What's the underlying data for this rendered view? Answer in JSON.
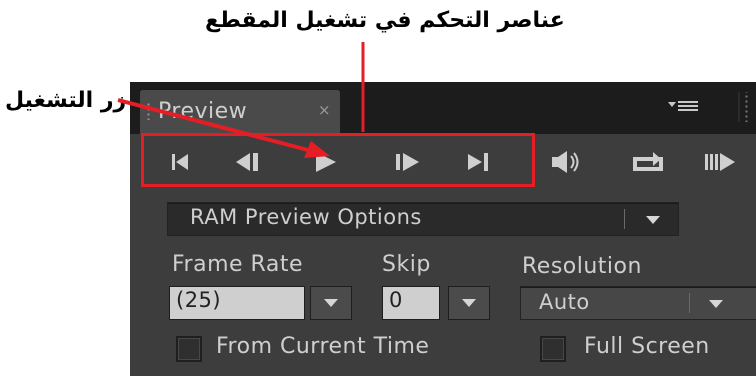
{
  "annotations": {
    "controls_callout": "عناصر التحكم في تشغيل المقطع",
    "play_callout": "زر التشغيل",
    "highlight_color": "#e51e25"
  },
  "panel": {
    "tab_title": "Preview",
    "tab_close_glyph": "×",
    "menu_icon": "panel-menu-icon"
  },
  "transport": {
    "buttons": [
      {
        "name": "first-frame",
        "icon": "skip-to-start-icon"
      },
      {
        "name": "previous-frame",
        "icon": "step-back-icon"
      },
      {
        "name": "play",
        "icon": "play-icon"
      },
      {
        "name": "next-frame",
        "icon": "step-forward-icon"
      },
      {
        "name": "last-frame",
        "icon": "skip-to-end-icon"
      },
      {
        "name": "mute-audio",
        "icon": "speaker-icon"
      },
      {
        "name": "loop",
        "icon": "loop-icon"
      },
      {
        "name": "ram-preview",
        "icon": "ram-preview-icon"
      }
    ]
  },
  "options": {
    "preview_mode": "RAM Preview Options",
    "frame_rate_label": "Frame Rate",
    "frame_rate_value": "(25)",
    "skip_label": "Skip",
    "skip_value": "0",
    "resolution_label": "Resolution",
    "resolution_value": "Auto",
    "from_current_time_label": "From Current Time",
    "from_current_time_checked": false,
    "full_screen_label": "Full Screen",
    "full_screen_checked": false
  }
}
